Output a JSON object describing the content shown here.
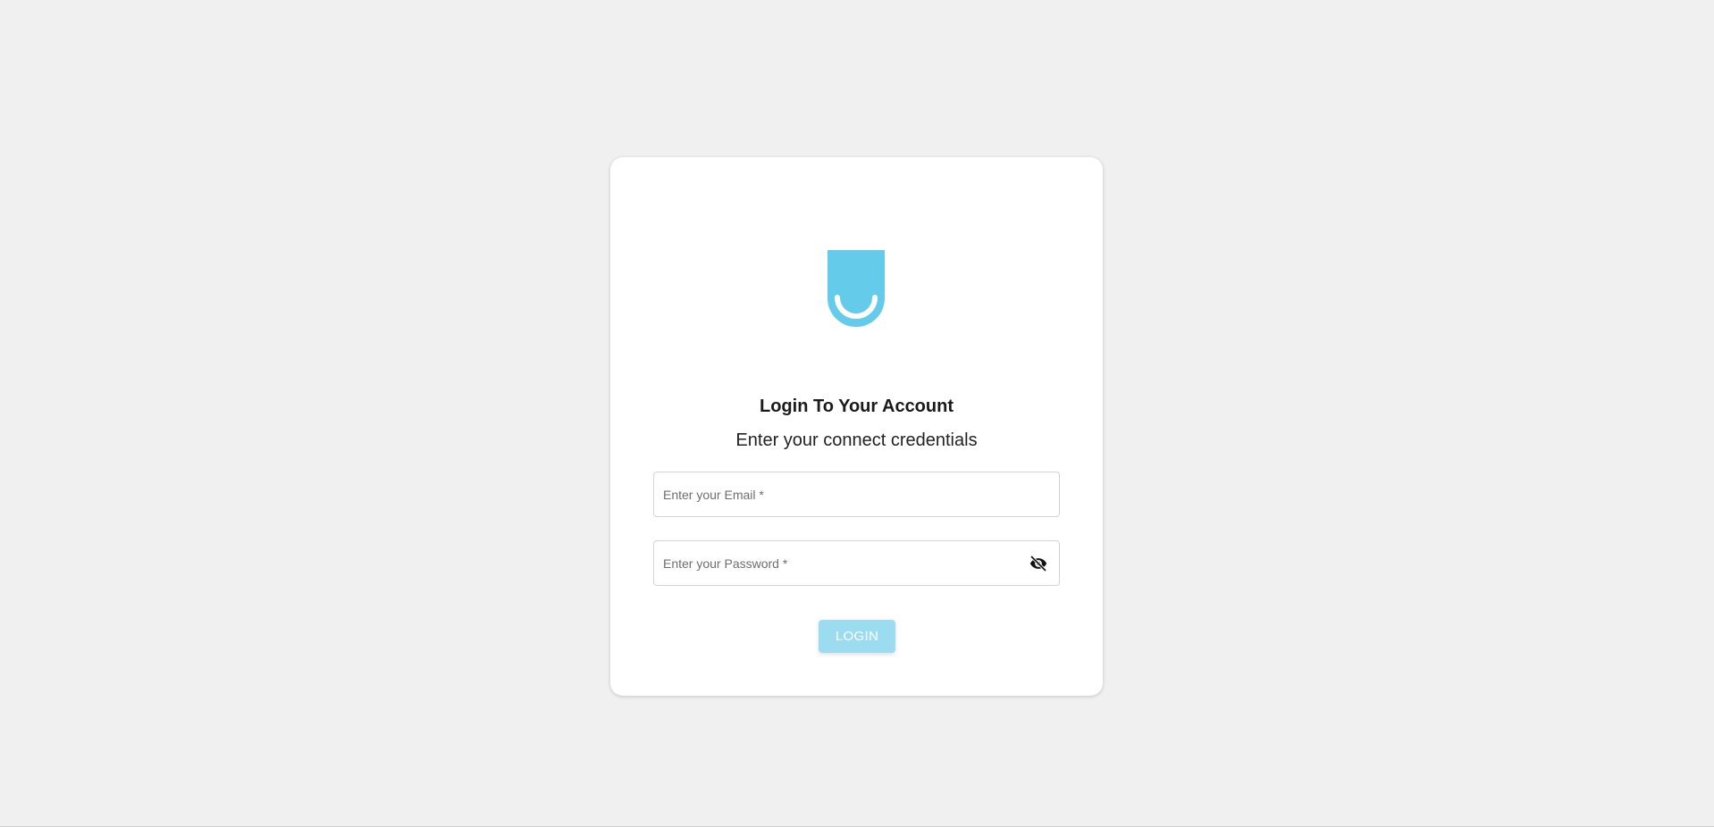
{
  "brand": {
    "logo_icon": "smile-bucket-logo",
    "accent_color": "#65cbea"
  },
  "login": {
    "title": "Login To Your Account",
    "subtitle": "Enter your connect credentials",
    "email_placeholder": "Enter your Email *",
    "password_placeholder": "Enter your Password *",
    "password_toggle_icon": "eye-off-icon",
    "button_label": "LOGIN",
    "button_color": "#9cdcf0"
  }
}
